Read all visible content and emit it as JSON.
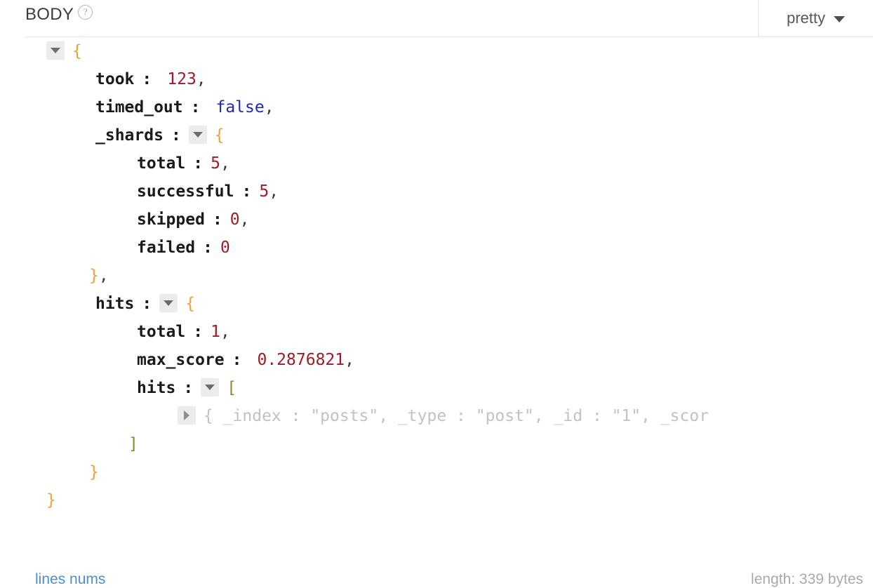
{
  "header": {
    "title": "BODY",
    "help_icon": "question-circle-icon",
    "format_selector": {
      "label": "pretty",
      "caret_icon": "chevron-down-icon"
    }
  },
  "json_body": {
    "lines": [
      {
        "id": "root-open",
        "toggle": "expanded",
        "open": "{"
      },
      {
        "id": "took",
        "key": "took",
        "colon": ":",
        "value": "123",
        "comma": ","
      },
      {
        "id": "timed_out",
        "key": "timed_out",
        "colon": ":",
        "value": "false",
        "comma": ","
      },
      {
        "id": "shards",
        "key": "_shards",
        "colon": ":",
        "toggle": "expanded",
        "open": "{"
      },
      {
        "id": "shards-total",
        "key": "total",
        "colon": ":",
        "value": "5",
        "comma": ","
      },
      {
        "id": "shards-successful",
        "key": "successful",
        "colon": ":",
        "value": "5",
        "comma": ","
      },
      {
        "id": "shards-skipped",
        "key": "skipped",
        "colon": ":",
        "value": "0",
        "comma": ","
      },
      {
        "id": "shards-failed",
        "key": "failed",
        "colon": ":",
        "value": "0",
        "comma": ""
      },
      {
        "id": "shards-close",
        "close": "}",
        "comma": ","
      },
      {
        "id": "hits",
        "key": "hits",
        "colon": ":",
        "toggle": "expanded",
        "open": "{"
      },
      {
        "id": "hits-total",
        "key": "total",
        "colon": ":",
        "value": "1",
        "comma": ","
      },
      {
        "id": "hits-max_score",
        "key": "max_score",
        "colon": ":",
        "value": "0.2876821",
        "comma": ","
      },
      {
        "id": "hits-hits",
        "key": "hits",
        "colon": ":",
        "toggle": "expanded",
        "open": "["
      },
      {
        "id": "hits-hits-item",
        "toggle": "collapsed",
        "preview": "{ _index :  \"posts\",  _type :  \"post\",  _id :  \"1\",  _scor"
      },
      {
        "id": "hits-hits-close",
        "close": "]"
      },
      {
        "id": "hits-close",
        "close": "}"
      },
      {
        "id": "root-close",
        "close": "}"
      }
    ],
    "values": {
      "took": 123,
      "timed_out": false,
      "_shards": {
        "total": 5,
        "successful": 5,
        "skipped": 0,
        "failed": 0
      },
      "hits": {
        "total": 1,
        "max_score": 0.2876821,
        "hits": [
          {
            "_index": "posts",
            "_type": "post",
            "_id": "1"
          }
        ]
      }
    }
  },
  "footer": {
    "lines_nums_label": "lines nums",
    "length_label": "length: 339 bytes"
  },
  "colors": {
    "key": "#1a1a1a",
    "number": "#a11b26",
    "boolean": "#2326b8",
    "brace": "#e8a33d",
    "bracket": "#8a8a2b",
    "preview": "#c2c2c2",
    "link": "#4a8fd4",
    "muted": "#a9a9a9"
  }
}
